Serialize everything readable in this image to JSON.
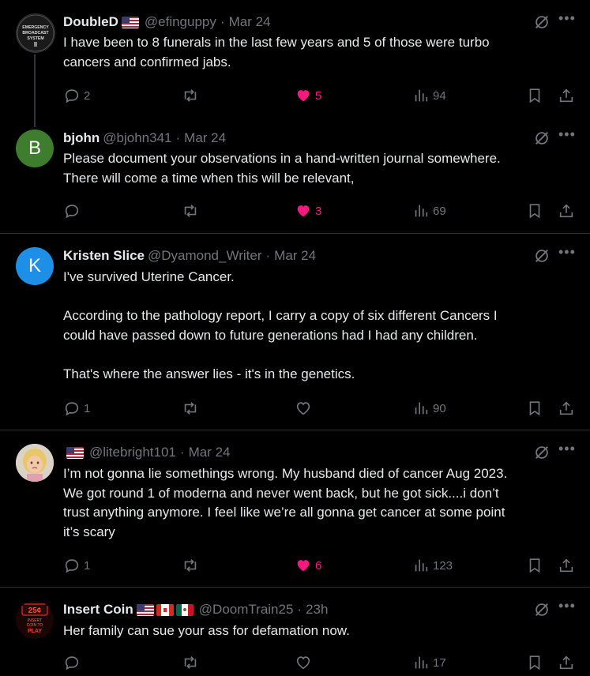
{
  "posts": [
    {
      "name": "DoubleD",
      "flags": [
        "us"
      ],
      "handle": "@efinguppy",
      "date": "Mar 24",
      "avatar_text": "EMERGENCY BROADCAST SYSTEM",
      "text": "I have been to 8 funerals in the last few years and 5 of those were turbo\ncancers and confirmed jabs.",
      "replies": "2",
      "reposts": "",
      "likes": "5",
      "liked": true,
      "views": "94"
    },
    {
      "name": "bjohn",
      "flags": [],
      "handle": "@bjohn341",
      "date": "Mar 24",
      "avatar_letter": "B",
      "avatar_color": "#3d7d2d",
      "text": "Please document your observations in a hand-written journal somewhere.\nThere will come a time when this will be relevant,",
      "replies": "",
      "reposts": "",
      "likes": "3",
      "liked": true,
      "views": "69"
    },
    {
      "name": "Kristen Slice",
      "flags": [],
      "handle": "@Dyamond_Writer",
      "date": "Mar 24",
      "avatar_letter": "K",
      "avatar_color": "#1d8fe6",
      "text": "I've survived Uterine Cancer.\n\nAccording to the pathology report, I carry a copy of six different Cancers I\ncould have passed down to future generations had I had any children.\n\nThat's where the answer lies - it's in the genetics.",
      "replies": "1",
      "reposts": "",
      "likes": "",
      "liked": false,
      "views": "90"
    },
    {
      "name": "",
      "flags": [
        "us"
      ],
      "handle": "@litebright101",
      "date": "Mar 24",
      "text": "I’m not gonna lie somethings wrong. My husband died of cancer Aug 2023.\nWe got round 1 of moderna and never went back, but he got sick....i don’t\ntrust anything anymore. I feel like we’re all gonna get cancer at some point\nit’s scary",
      "replies": "1",
      "reposts": "",
      "likes": "6",
      "liked": true,
      "views": "123"
    },
    {
      "name": "Insert Coin",
      "flags": [
        "us",
        "ca",
        "mx"
      ],
      "handle": "@DoomTrain25",
      "date": "23h",
      "avatar_text": "25¢ INSERT COIN TO PLAY",
      "text": "Her family can sue your ass for defamation now.",
      "replies": "",
      "reposts": "",
      "likes": "",
      "liked": false,
      "views": "17"
    }
  ],
  "icons": {
    "reply": "reply-icon",
    "repost": "repost-icon",
    "like": "heart-icon",
    "views": "views-icon",
    "bookmark": "bookmark-icon",
    "share": "share-icon",
    "grok": "grok-icon",
    "more": "more-icon"
  },
  "colors": {
    "like": "#f91880",
    "muted": "#71767b",
    "text": "#e7e9ea",
    "border": "#2f3336"
  }
}
